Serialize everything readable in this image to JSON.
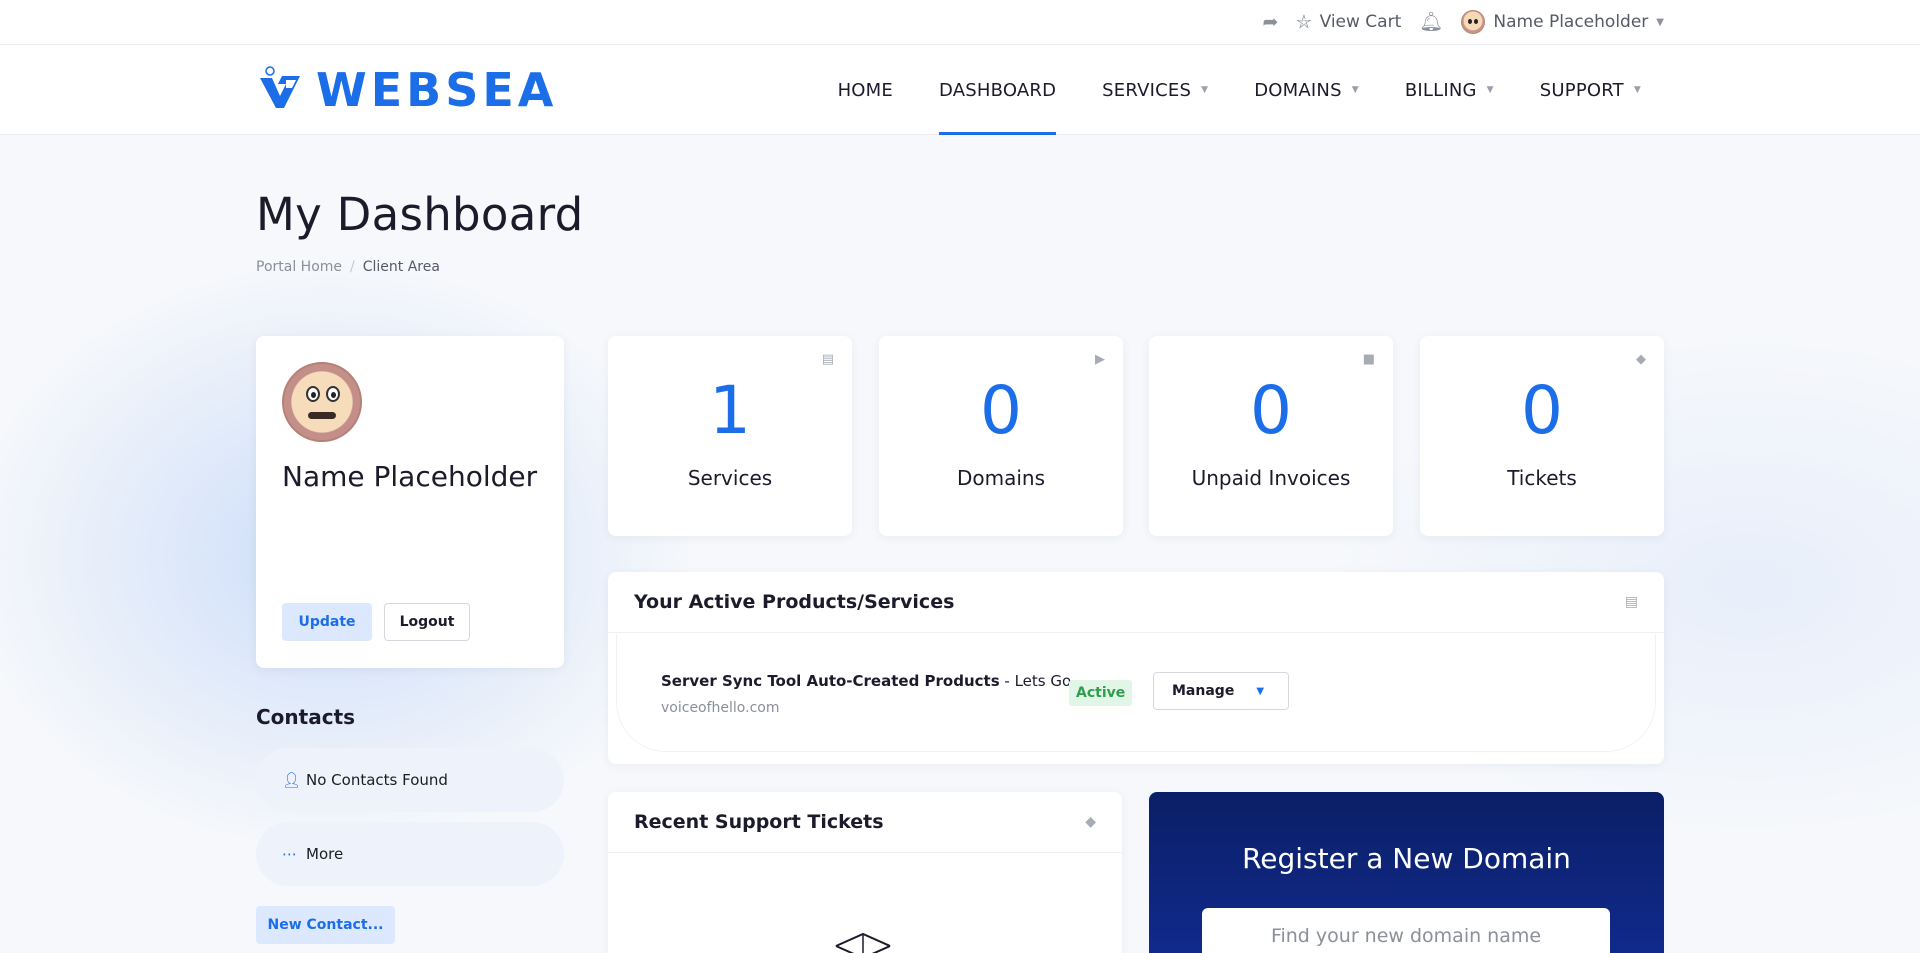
{
  "topbar": {
    "view_cart": "View Cart",
    "user_name": "Name Placeholder",
    "icons": [
      "share-icon",
      "basket-icon",
      "bell-icon",
      "avatar"
    ]
  },
  "logo": {
    "text": "WEBSEA",
    "brand_color": "#1c6ee8"
  },
  "nav": {
    "items": [
      {
        "label": "HOME",
        "active": false,
        "dropdown": false
      },
      {
        "label": "DASHBOARD",
        "active": true,
        "dropdown": false
      },
      {
        "label": "SERVICES",
        "active": false,
        "dropdown": true
      },
      {
        "label": "DOMAINS",
        "active": false,
        "dropdown": true
      },
      {
        "label": "BILLING",
        "active": false,
        "dropdown": true
      },
      {
        "label": "SUPPORT",
        "active": false,
        "dropdown": true
      }
    ]
  },
  "page": {
    "title": "My Dashboard",
    "breadcrumb": [
      "Portal Home",
      "Client Area"
    ]
  },
  "profile": {
    "name": "Name Placeholder",
    "update_label": "Update",
    "logout_label": "Logout"
  },
  "contacts": {
    "title": "Contacts",
    "empty": "No Contacts Found",
    "more": "More",
    "new_label": "New Contact..."
  },
  "stats": [
    {
      "value": "1",
      "label": "Services",
      "icon": "server-icon"
    },
    {
      "value": "0",
      "label": "Domains",
      "icon": "tag-icon"
    },
    {
      "value": "0",
      "label": "Unpaid Invoices",
      "icon": "file-icon"
    },
    {
      "value": "0",
      "label": "Tickets",
      "icon": "ticket-icon"
    }
  ],
  "products": {
    "title": "Your Active Products/Services",
    "rows": [
      {
        "name": "Server Sync Tool Auto-Created Products",
        "suffix": " - Lets Go",
        "domain": "voiceofhello.com",
        "status": "Active",
        "manage_label": "Manage"
      }
    ]
  },
  "tickets": {
    "title": "Recent Support Tickets"
  },
  "domain_register": {
    "title": "Register a New Domain",
    "placeholder": "Find your new domain name"
  }
}
